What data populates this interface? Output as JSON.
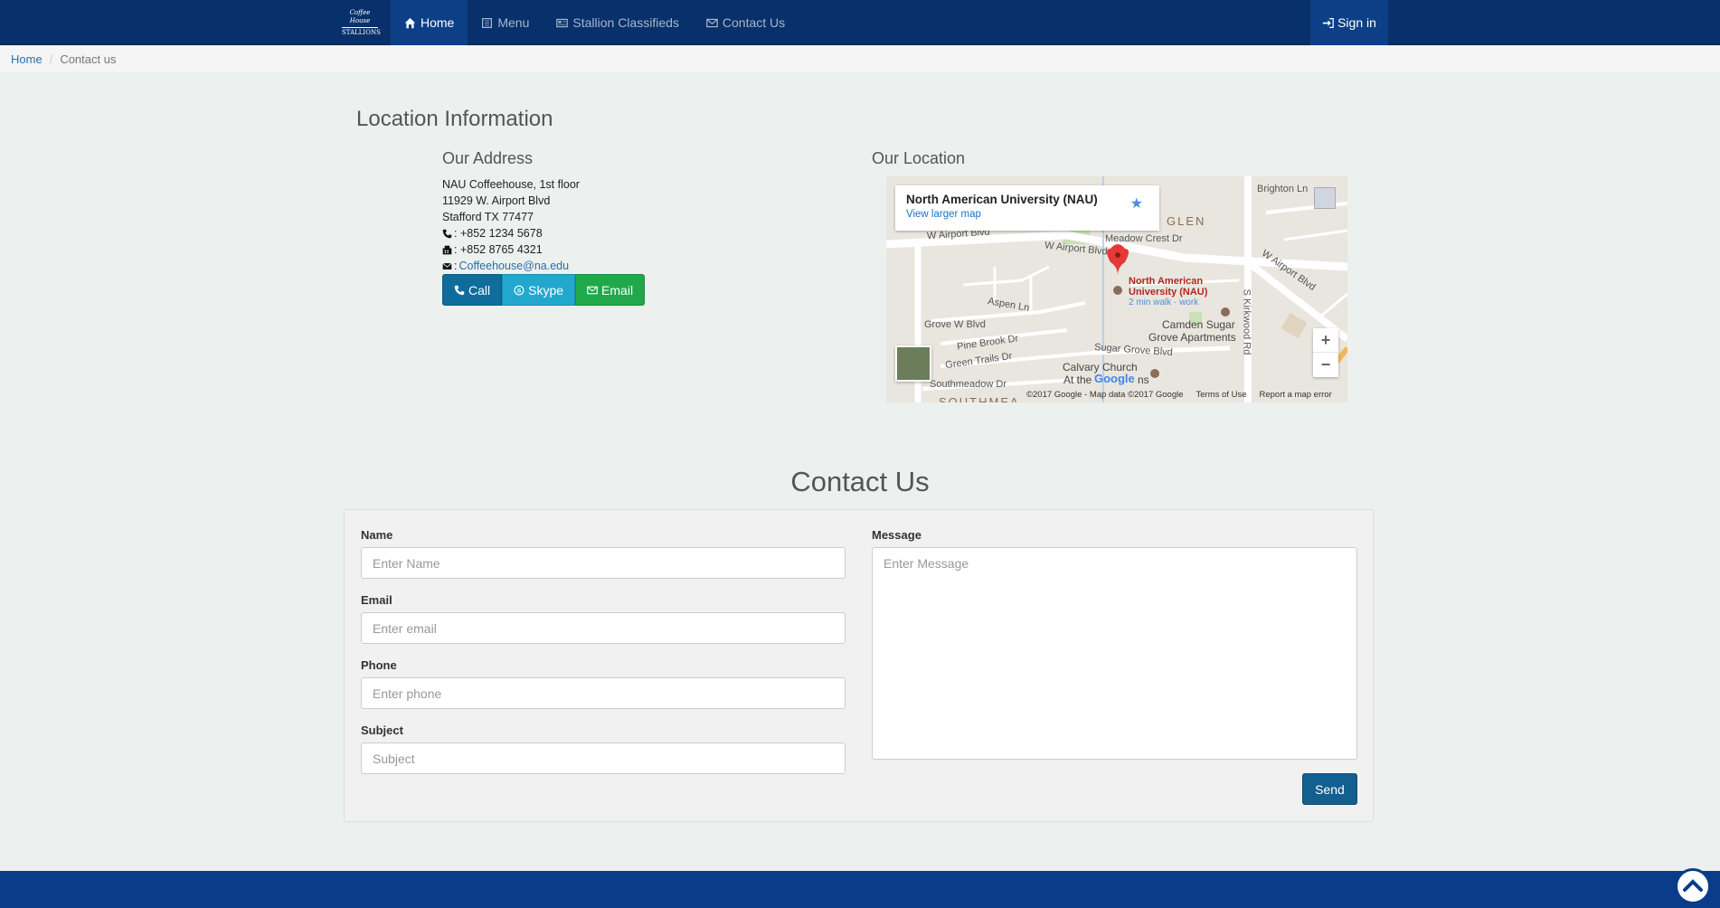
{
  "brand": {
    "line1": "Coffee House",
    "line2": "STALLIONS"
  },
  "nav": {
    "home": "Home",
    "menu": "Menu",
    "classifieds": "Stallion Classifieds",
    "contact": "Contact Us",
    "signin": "Sign in"
  },
  "breadcrumb": {
    "home": "Home",
    "current": "Contact us"
  },
  "location": {
    "title": "Location Information",
    "address_heading": "Our Address",
    "address_lines": [
      "NAU Coffeehouse, 1st floor",
      "11929 W. Airport Blvd",
      "Stafford TX 77477"
    ],
    "phone": ": +852 1234 5678",
    "fax": ": +852 8765 4321",
    "email_prefix": ":",
    "email": "Coffeehouse@na.edu",
    "buttons": {
      "call": "Call",
      "skype": "Skype",
      "email": "Email"
    },
    "map_heading": "Our Location"
  },
  "map": {
    "place_name": "North American University (NAU)",
    "view_larger": "View larger map",
    "poi_line1": "North American",
    "poi_line2": "University (NAU)",
    "poi_walk": "2 min walk · work",
    "labels": {
      "brighton": "Brighton Ln",
      "glen": "GLEN",
      "meadow": "Meadow Crest Dr",
      "airport1": "W Airport Blvd",
      "airport2": "W Airport Blvd",
      "airport3": "W Airport Blvd",
      "kirkwood": "S Kirkwood Rd",
      "aspen": "Aspen Ln",
      "grove": "Grove W Blvd",
      "pinebrook": "Pine Brook Dr",
      "greentrails": "Green Trails Dr",
      "southmeadow": "Southmeadow Dr",
      "southmea": "SOUTHMEA",
      "camden1": "Camden Sugar",
      "camden2": "Grove Apartments",
      "sugargrove": "Sugar Grove Blvd",
      "calvary1": "Calvary Church",
      "calvary2": "At the",
      "calvary3": "ns"
    },
    "google": "Google",
    "zoom_in": "+",
    "zoom_out": "−",
    "footer": {
      "copyright": "©2017 Google - Map data ©2017 Google",
      "terms": "Terms of Use",
      "report": "Report a map error"
    }
  },
  "contact": {
    "title": "Contact Us",
    "name_label": "Name",
    "name_placeholder": "Enter Name",
    "email_label": "Email",
    "email_placeholder": "Enter email",
    "phone_label": "Phone",
    "phone_placeholder": "Enter phone",
    "subject_label": "Subject",
    "subject_placeholder": "Subject",
    "message_label": "Message",
    "message_placeholder": "Enter Message",
    "send": "Send"
  },
  "colors": {
    "navbar": "#08306a",
    "footer": "#0a3c8a",
    "accent": "#135f8f"
  }
}
